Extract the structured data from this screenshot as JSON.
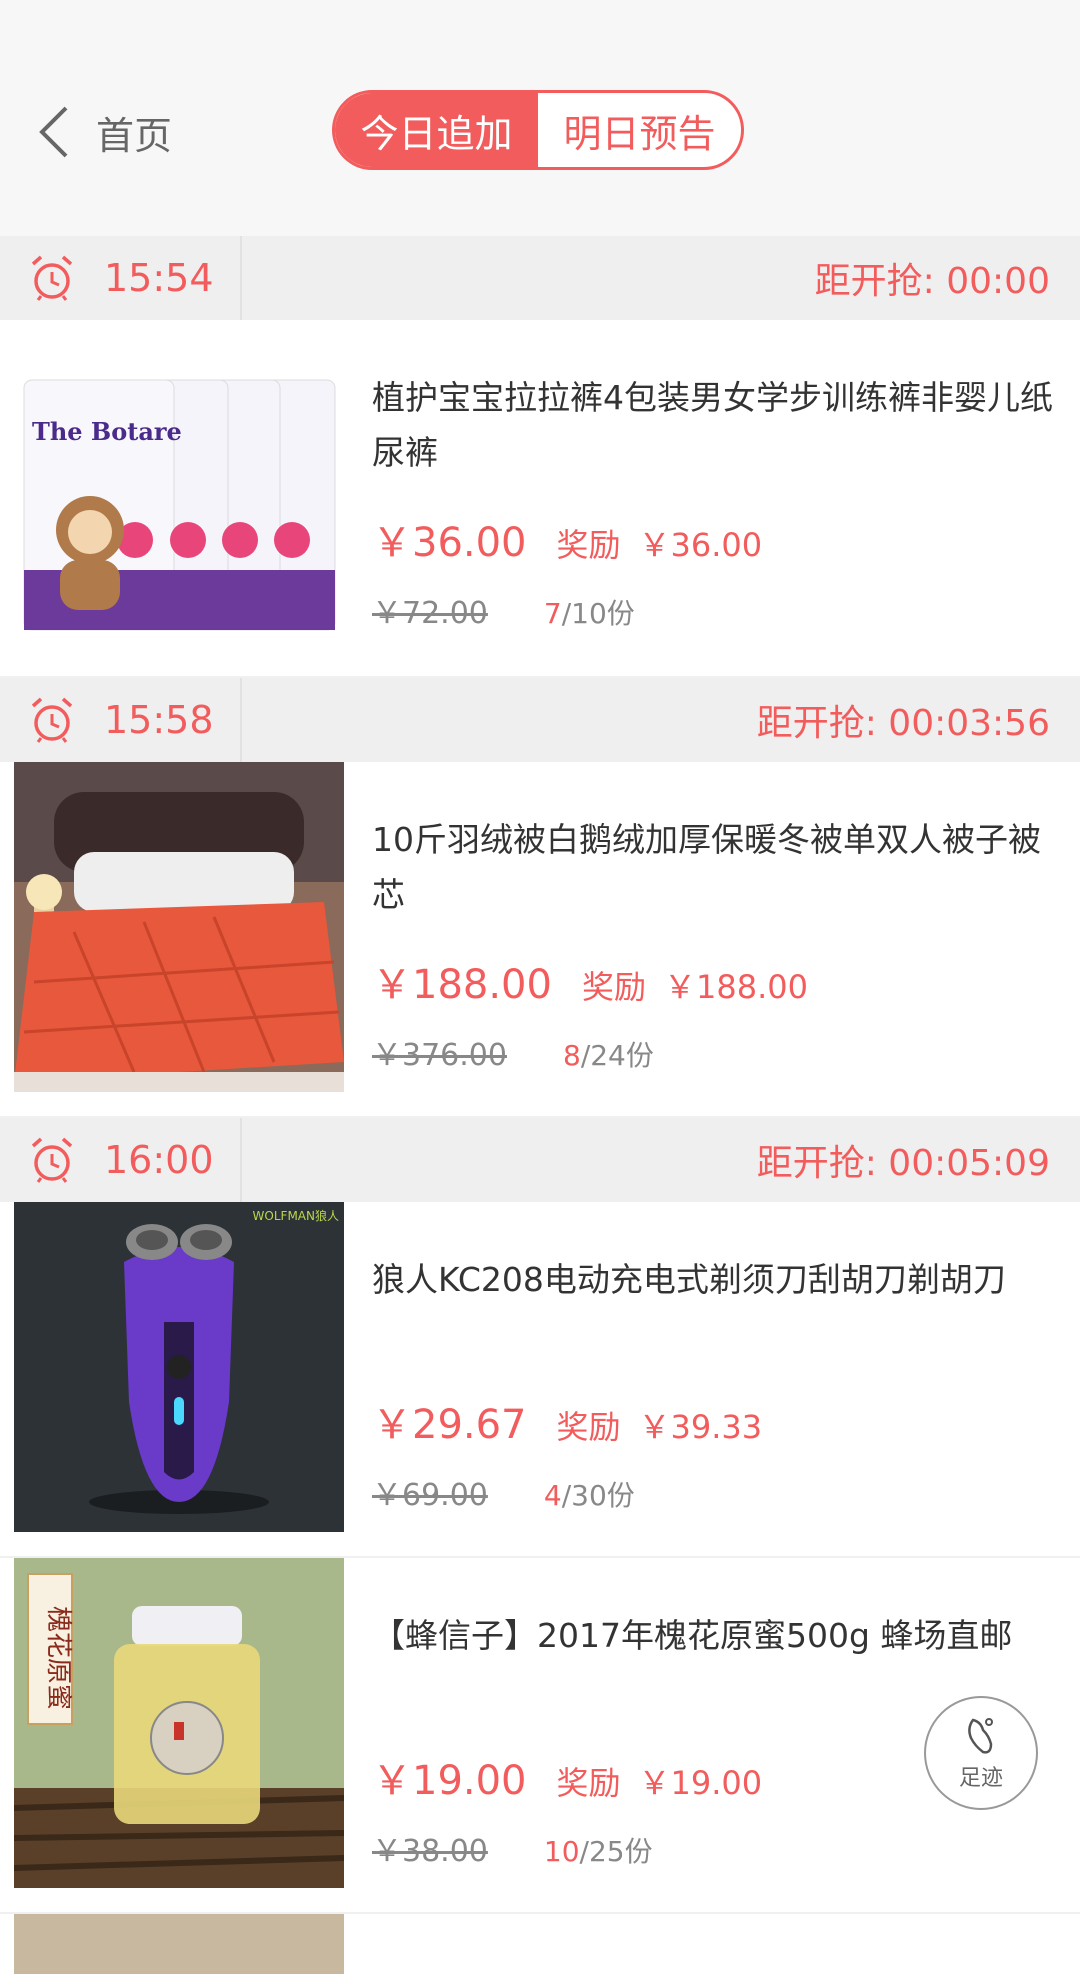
{
  "header": {
    "back_label": "首页",
    "tabs": [
      "今日追加",
      "明日预告"
    ],
    "active_tab": 0
  },
  "accent_color": "#f25c5c",
  "sections": [
    {
      "time": "15:54",
      "countdown": "距开抢: 00:00",
      "item": {
        "title": "植护宝宝拉拉裤4包装男女学步训练裤非婴儿纸尿裤",
        "price": "￥36.00",
        "reward_label": "奖励",
        "reward": "￥36.00",
        "original_price": "￥72.00",
        "sold": "7",
        "total": "/10份",
        "image": "diaper-pack-image",
        "image_text": "The Botare"
      }
    },
    {
      "time": "15:58",
      "countdown": "距开抢: 00:03:56",
      "item": {
        "title": "10斤羽绒被白鹅绒加厚保暖冬被单双人被子被芯",
        "price": "￥188.00",
        "reward_label": "奖励",
        "reward": "￥188.00",
        "original_price": "￥376.00",
        "sold": "8",
        "total": "/24份",
        "image": "duvet-image"
      }
    },
    {
      "time": "16:00",
      "countdown": "距开抢: 00:05:09",
      "item": {
        "title": "狼人KC208电动充电式剃须刀刮胡刀剃胡刀",
        "price": "￥29.67",
        "reward_label": "奖励",
        "reward": "￥39.33",
        "original_price": "￥69.00",
        "sold": "4",
        "total": "/30份",
        "image": "shaver-image",
        "brand_text": "WOLFMAN狼人"
      }
    },
    {
      "time": "",
      "countdown": "",
      "item": {
        "title": "【蜂信子】2017年槐花原蜜500g 蜂场直邮",
        "price": "￥19.00",
        "reward_label": "奖励",
        "reward": "￥19.00",
        "original_price": "￥38.00",
        "sold": "10",
        "total": "/25份",
        "image": "honey-jar-image",
        "label_text": "槐花原蜜"
      }
    }
  ],
  "footprint_label": "足迹"
}
